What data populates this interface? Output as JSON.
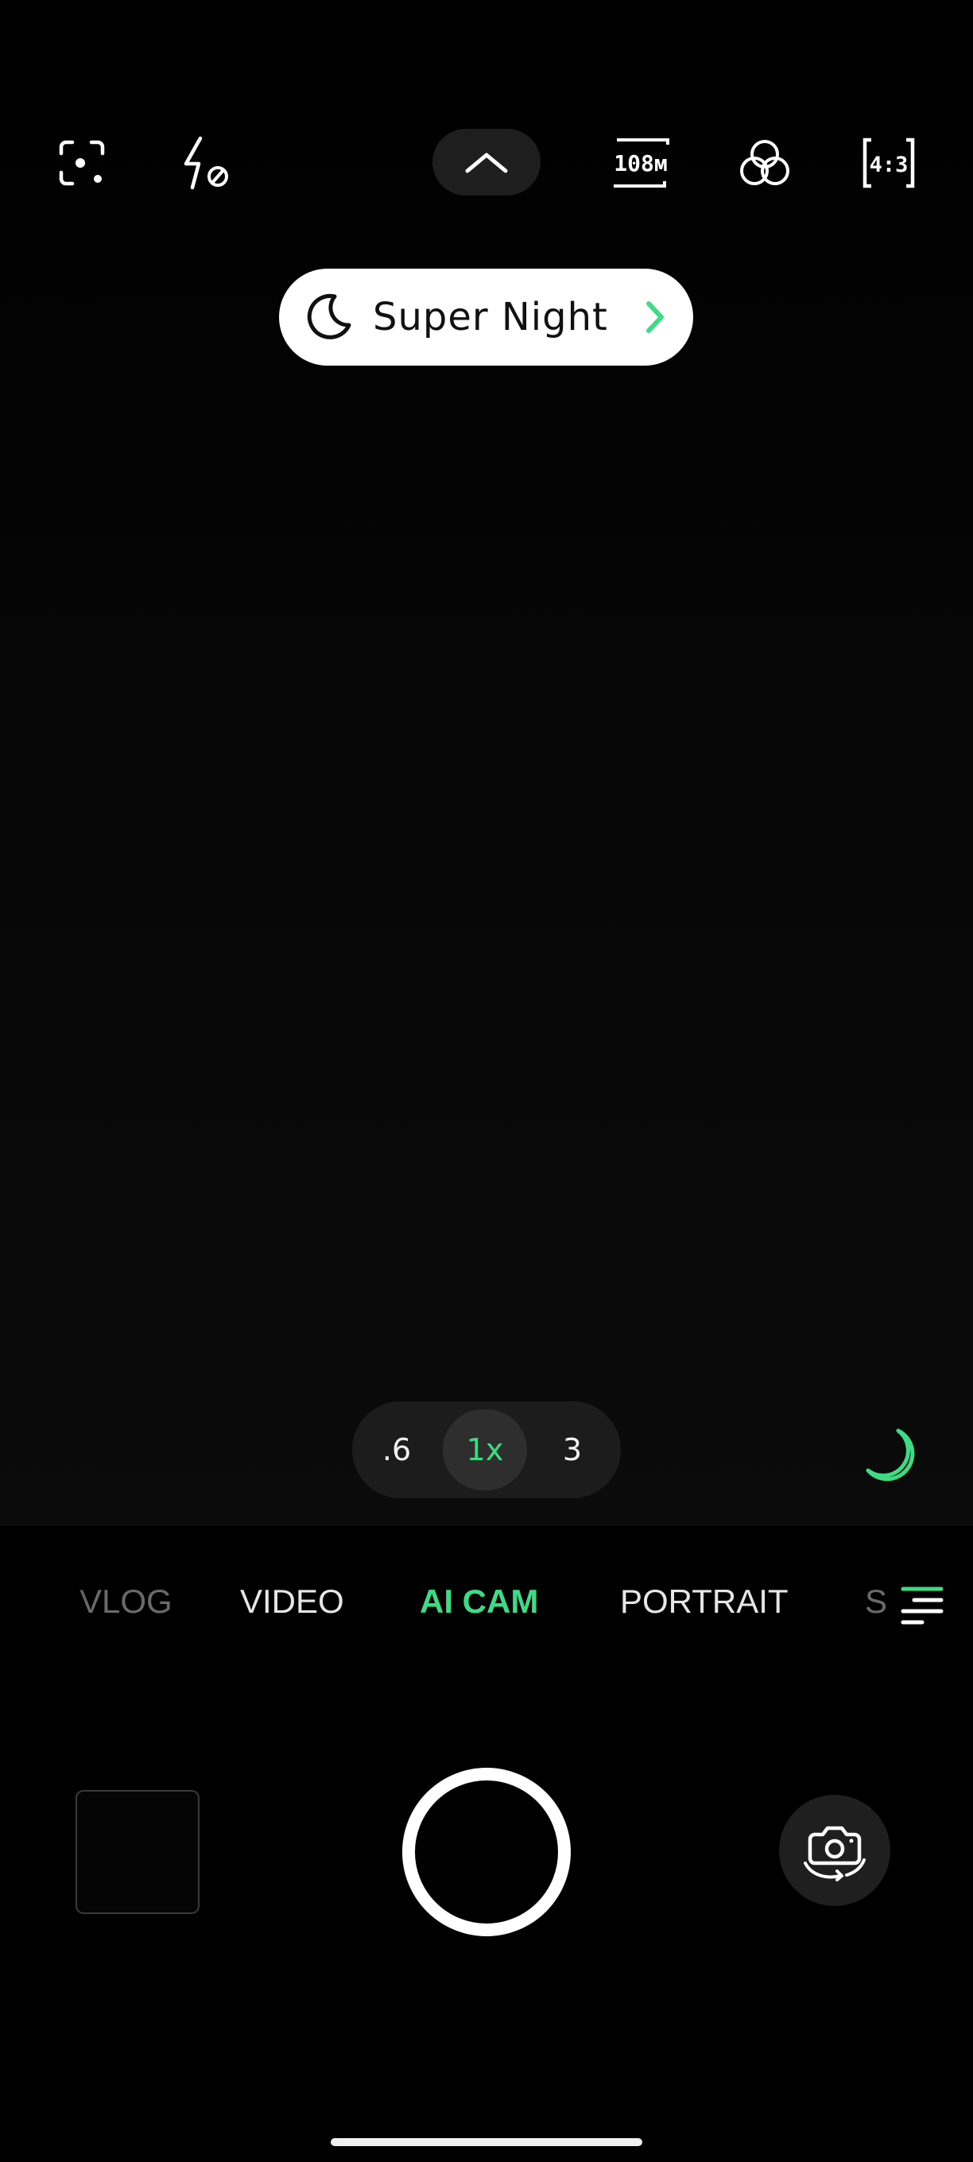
{
  "top_bar": {
    "icons": [
      "focus-scan-icon",
      "flash-off-icon",
      "chevron-up-icon",
      "resolution-108m-icon",
      "filters-icon",
      "aspect-ratio-icon"
    ],
    "resolution_label": "108м",
    "aspect_ratio_label": "4:3"
  },
  "scene_chip": {
    "icon": "moon-icon",
    "label": "Super Night",
    "arrow_icon": "chevron-right-icon"
  },
  "zoom": {
    "options": [
      ".6",
      "1x",
      "3"
    ],
    "selected": "1x"
  },
  "night_indicator_icon": "moon-icon",
  "modes": {
    "items": [
      "VLOG",
      "VIDEO",
      "AI CAM",
      "PORTRAIT",
      "SUPER NIGHT"
    ],
    "visible_labels": [
      "VLOG",
      "VIDEO",
      "AI CAM",
      "PORTRAIT",
      "S"
    ],
    "active": "AI CAM"
  },
  "bottom_controls": {
    "gallery_icon": "gallery-thumbnail",
    "shutter_icon": "shutter-button",
    "switch_icon": "switch-camera-icon"
  },
  "colors": {
    "accent": "#3ddc84",
    "background": "#000000",
    "chip_background": "#ffffff"
  }
}
